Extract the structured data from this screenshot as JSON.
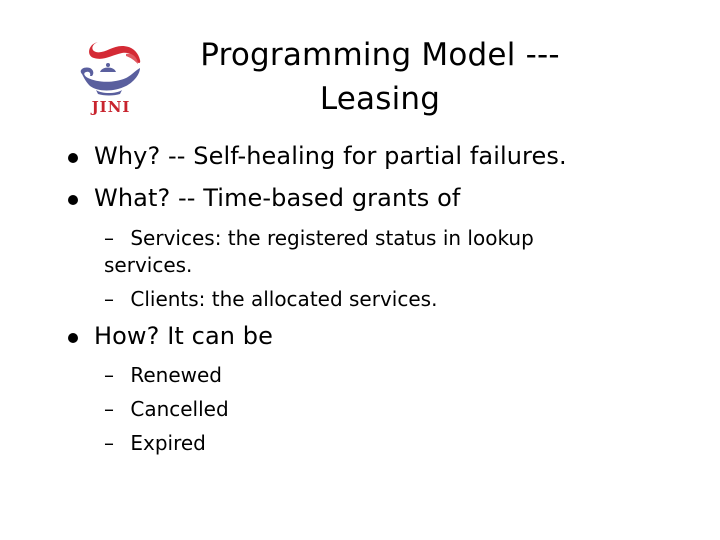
{
  "logo": {
    "name": "jini-logo",
    "text": "JINI",
    "colors": {
      "flame": "#d42a35",
      "lamp": "#5a5f9e",
      "wordmark": "#c8242e"
    }
  },
  "title": {
    "line1": "Programming Model ---",
    "line2": "Leasing"
  },
  "bullets": [
    {
      "text": "Why? -- Self-healing for partial failures."
    },
    {
      "text": "What? -- Time-based grants of",
      "sub": [
        {
          "dash": "–",
          "text": "Services: the registered status in lookup",
          "continuation": "services."
        },
        {
          "dash": "–",
          "text": "Clients: the allocated services."
        }
      ]
    },
    {
      "text": "How?  It can be",
      "sub": [
        {
          "dash": "–",
          "text": "Renewed"
        },
        {
          "dash": "–",
          "text": "Cancelled"
        },
        {
          "dash": "–",
          "text": "Expired"
        }
      ]
    }
  ]
}
